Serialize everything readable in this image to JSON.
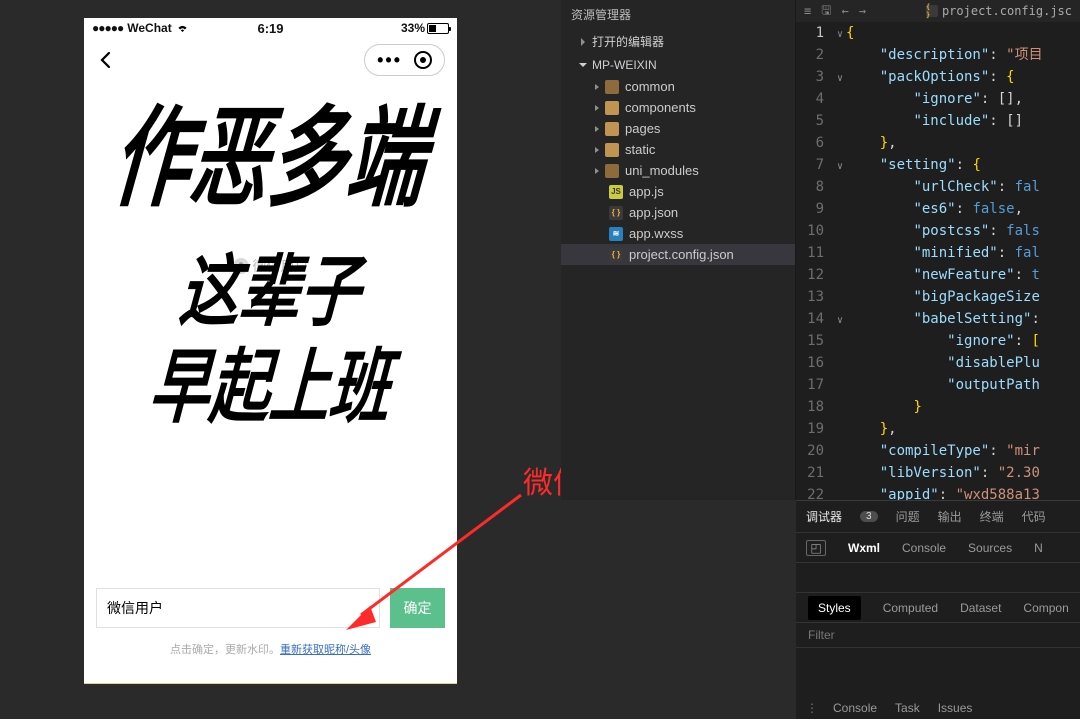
{
  "phone": {
    "status": {
      "carrier": "WeChat",
      "signal_dots": "●●●●●",
      "time": "6:19",
      "battery_pct": "33%"
    },
    "brush_lines": {
      "l1": "作恶多端",
      "l2": "这辈子",
      "l3": "早起上班"
    },
    "watermark_user": "微信用户",
    "input_value": "微信用户",
    "confirm_label": "确定",
    "hint_prefix": "点击确定，更新水印。",
    "hint_link": "重新获取昵称/头像"
  },
  "annotation": "微信头像水印",
  "explorer": {
    "title": "资源管理器",
    "sections": {
      "open_editors": "打开的编辑器",
      "project": "MP-WEIXIN"
    },
    "tree": {
      "common": "common",
      "components": "components",
      "pages": "pages",
      "static": "static",
      "uni_modules": "uni_modules",
      "app_js": "app.js",
      "app_json": "app.json",
      "app_wxss": "app.wxss",
      "project_cfg": "project.config.json"
    }
  },
  "editor": {
    "tab": "project.config.jsc",
    "lines": {
      "1": "{",
      "2": "\"description\": \"项目",
      "3": "\"packOptions\": {",
      "4": "\"ignore\": [],",
      "5": "\"include\": []",
      "6": "},",
      "7": "\"setting\": {",
      "8": "\"urlCheck\": fal",
      "9": "\"es6\": false,",
      "10": "\"postcss\": fals",
      "11": "\"minified\": fal",
      "12": "\"newFeature\": t",
      "13": "\"bigPackageSize",
      "14": "\"babelSetting\":",
      "15": "\"ignore\": [",
      "16": "\"disablePlu",
      "17": "\"outputPath",
      "18": "}",
      "19": "},",
      "20": "\"compileType\": \"mir",
      "21": "\"libVersion\": \"2.30",
      "22": "\"appid\": \"wxd588a13"
    }
  },
  "devtools": {
    "top_tabs": {
      "debugger": "调试器",
      "count": "3",
      "problems": "问题",
      "output": "输出",
      "terminal": "终端",
      "code": "代码"
    },
    "row2": {
      "wxml": "Wxml",
      "console": "Console",
      "sources": "Sources",
      "more": "N"
    },
    "row3": {
      "styles": "Styles",
      "computed": "Computed",
      "dataset": "Dataset",
      "compon": "Compon"
    },
    "filter_placeholder": "Filter",
    "foot": {
      "console": "Console",
      "task": "Task",
      "issues": "Issues"
    }
  }
}
